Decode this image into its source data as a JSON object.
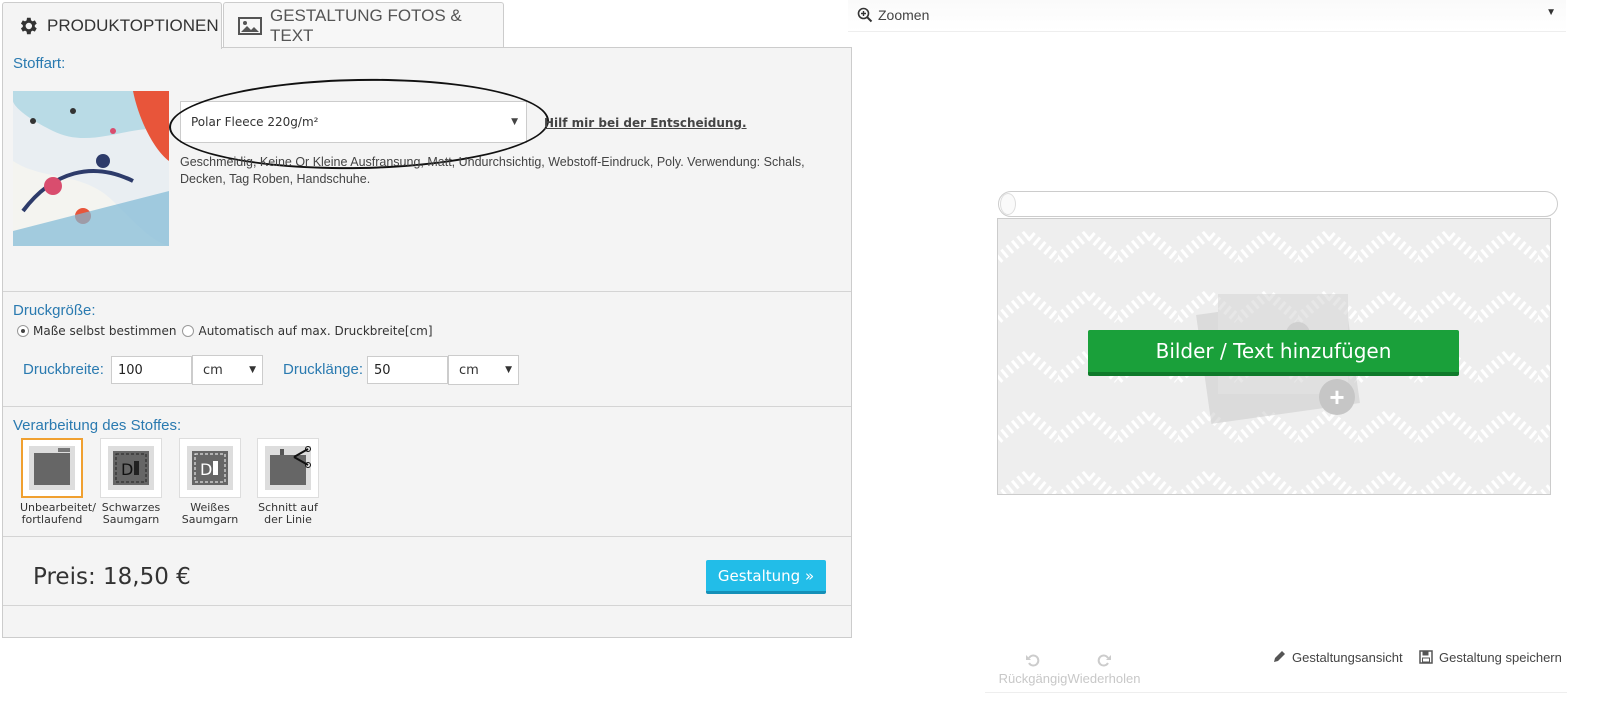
{
  "tabs": {
    "product_options": "PRODUKTOPTIONEN",
    "design_photos_text": "GESTALTUNG FOTOS & TEXT"
  },
  "fabric": {
    "title": "Stoffart:",
    "selected": "Polar Fleece 220g/m²",
    "help_link": "Hilf mir bei der Entscheidung.",
    "description": "Geschmeidig, Keine Or Kleine Ausfransung, Matt, Undurchsichtig, Webstoff-Eindruck, Poly. Verwendung: Schals, Decken, Tag Roben, Handschuhe."
  },
  "print_size": {
    "title": "Druckgröße:",
    "option_custom": "Maße selbst bestimmen",
    "option_auto": "Automatisch auf max. Druckbreite[cm]",
    "width_label": "Druckbreite:",
    "width_value": "100",
    "width_unit": "cm",
    "length_label": "Drucklänge:",
    "length_value": "50",
    "length_unit": "cm"
  },
  "finishing": {
    "title": "Verarbeitung des Stoffes:",
    "options": [
      {
        "line1": "Unbearbeitet/",
        "line2": "fortlaufend"
      },
      {
        "line1": "Schwarzes",
        "line2": "Saumgarn"
      },
      {
        "line1": "Weißes",
        "line2": "Saumgarn"
      },
      {
        "line1": "Schnitt auf",
        "line2": "der Linie"
      }
    ]
  },
  "pricing": {
    "price": "Preis: 18,50 €",
    "design_button": "Gestaltung »"
  },
  "editor": {
    "zoom_label": "Zoomen",
    "add_button": "Bilder / Text hinzufügen",
    "undo": "Rückgängig",
    "redo": "Wiederholen",
    "design_view": "Gestaltungsansicht",
    "save_design": "Gestaltung speichern"
  },
  "colors": {
    "accent_blue": "#2a7ab0",
    "design_button": "#22bde8",
    "add_button": "#1aa03a",
    "selected_border": "#f0a030"
  }
}
